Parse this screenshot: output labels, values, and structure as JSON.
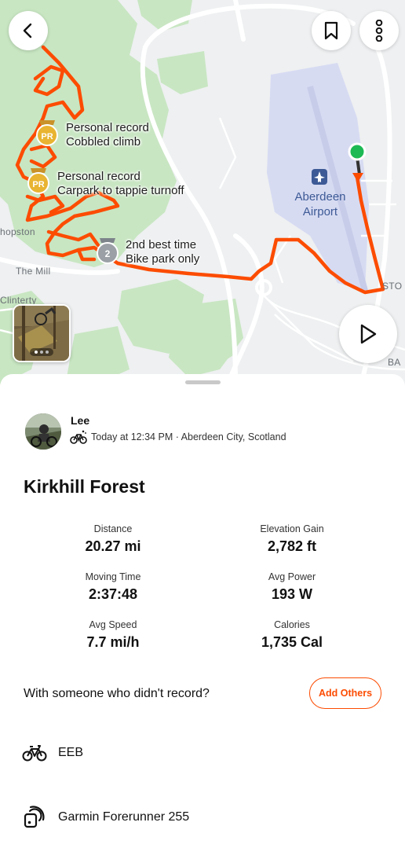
{
  "map": {
    "place_labels": {
      "hopston": "hopston",
      "the_mill": "The Mill",
      "clinterty": "Clinterty",
      "stoneywood": "STO",
      "bank": "BA"
    },
    "airport_label": "Aberdeen\nAirport",
    "segments": [
      {
        "status": "Personal record",
        "name": "Cobbled climb",
        "badge": "PR"
      },
      {
        "status": "Personal record",
        "name": "Carpark to tappie turnoff",
        "badge": "PR"
      },
      {
        "status": "2nd best time",
        "name": "Bike park only",
        "badge": "2"
      }
    ],
    "route_color": "#fc4c02",
    "start_color": "#1db954"
  },
  "toolbar": {
    "back_icon": "chevron-left-icon",
    "bookmark_icon": "bookmark-icon",
    "more_icon": "more-vertical-icon",
    "play_icon": "play-icon"
  },
  "activity": {
    "athlete_name": "Lee",
    "activity_type_icon": "ebike-icon",
    "meta": "Today at 12:34 PM · Aberdeen City, Scotland",
    "title": "Kirkhill Forest"
  },
  "stats": [
    {
      "label": "Distance",
      "value": "20.27 mi"
    },
    {
      "label": "Elevation Gain",
      "value": "2,782 ft"
    },
    {
      "label": "Moving Time",
      "value": "2:37:48"
    },
    {
      "label": "Avg Power",
      "value": "193 W"
    },
    {
      "label": "Avg Speed",
      "value": "7.7 mi/h"
    },
    {
      "label": "Calories",
      "value": "1,735 Cal"
    }
  ],
  "with_others": {
    "prompt": "With someone who didn't record?",
    "button": "Add Others"
  },
  "gear": {
    "bike": "EEB",
    "device": "Garmin Forerunner 255"
  },
  "colors": {
    "accent": "#fc4c02",
    "pr_gold": "#e8b431",
    "silver": "#9aa0a6"
  }
}
